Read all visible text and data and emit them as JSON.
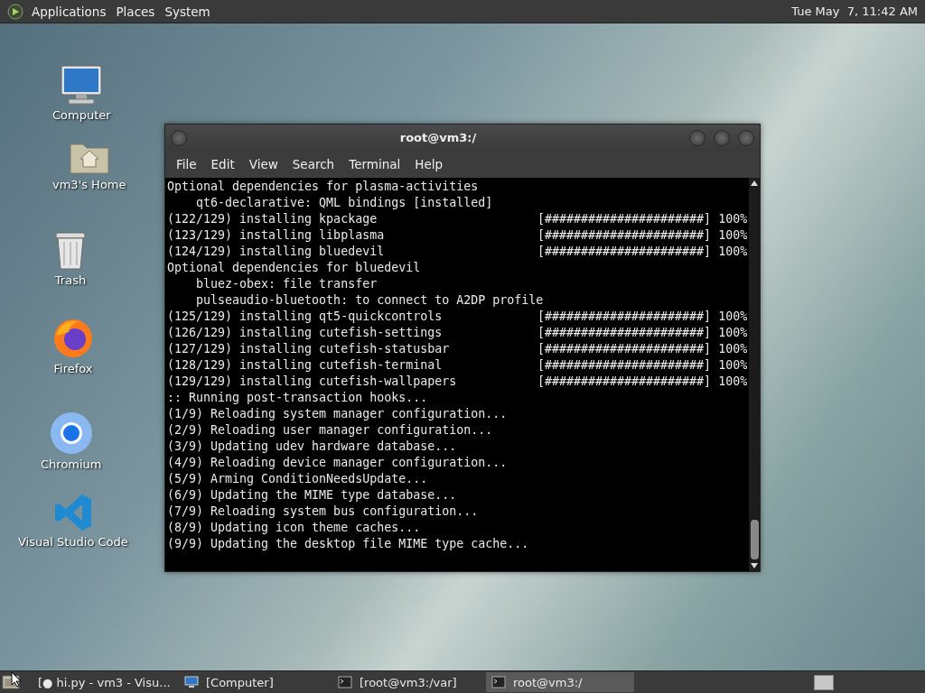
{
  "top_panel": {
    "menus": [
      "Applications",
      "Places",
      "System"
    ],
    "clock": "Tue May  7, 11:42 AM"
  },
  "desktop_icons": [
    {
      "kind": "computer",
      "label": "Computer"
    },
    {
      "kind": "home",
      "label": "vm3's Home"
    },
    {
      "kind": "trash",
      "label": "Trash"
    },
    {
      "kind": "firefox",
      "label": "Firefox"
    },
    {
      "kind": "chromium",
      "label": "Chromium"
    },
    {
      "kind": "vscode",
      "label": "Visual Studio Code"
    }
  ],
  "window": {
    "title": "root@vm3:/",
    "menus": [
      "File",
      "Edit",
      "View",
      "Search",
      "Terminal",
      "Help"
    ],
    "lines": [
      {
        "kind": "text",
        "text": "Optional dependencies for plasma-activities"
      },
      {
        "kind": "text",
        "text": "    qt6-declarative: QML bindings [installed]"
      },
      {
        "kind": "progress",
        "text": "(122/129) installing kpackage",
        "bar": "[######################]",
        "percent": "100%"
      },
      {
        "kind": "progress",
        "text": "(123/129) installing libplasma",
        "bar": "[######################]",
        "percent": "100%"
      },
      {
        "kind": "progress",
        "text": "(124/129) installing bluedevil",
        "bar": "[######################]",
        "percent": "100%"
      },
      {
        "kind": "text",
        "text": "Optional dependencies for bluedevil"
      },
      {
        "kind": "text",
        "text": "    bluez-obex: file transfer"
      },
      {
        "kind": "text",
        "text": "    pulseaudio-bluetooth: to connect to A2DP profile"
      },
      {
        "kind": "progress",
        "text": "(125/129) installing qt5-quickcontrols",
        "bar": "[######################]",
        "percent": "100%"
      },
      {
        "kind": "progress",
        "text": "(126/129) installing cutefish-settings",
        "bar": "[######################]",
        "percent": "100%"
      },
      {
        "kind": "progress",
        "text": "(127/129) installing cutefish-statusbar",
        "bar": "[######################]",
        "percent": "100%"
      },
      {
        "kind": "progress",
        "text": "(128/129) installing cutefish-terminal",
        "bar": "[######################]",
        "percent": "100%"
      },
      {
        "kind": "progress",
        "text": "(129/129) installing cutefish-wallpapers",
        "bar": "[######################]",
        "percent": "100%"
      },
      {
        "kind": "text",
        "text": ":: Running post-transaction hooks..."
      },
      {
        "kind": "text",
        "text": "(1/9) Reloading system manager configuration..."
      },
      {
        "kind": "text",
        "text": "(2/9) Reloading user manager configuration..."
      },
      {
        "kind": "text",
        "text": "(3/9) Updating udev hardware database..."
      },
      {
        "kind": "text",
        "text": "(4/9) Reloading device manager configuration..."
      },
      {
        "kind": "text",
        "text": "(5/9) Arming ConditionNeedsUpdate..."
      },
      {
        "kind": "text",
        "text": "(6/9) Updating the MIME type database..."
      },
      {
        "kind": "text",
        "text": "(7/9) Reloading system bus configuration..."
      },
      {
        "kind": "text",
        "text": "(8/9) Updating icon theme caches..."
      },
      {
        "kind": "text",
        "text": "(9/9) Updating the desktop file MIME type cache..."
      }
    ]
  },
  "taskbar": {
    "tasks": [
      {
        "kind": "vscode",
        "label": "[● hi.py - vm3 - Visu...",
        "selected": false
      },
      {
        "kind": "computer",
        "label": "[Computer]",
        "selected": false
      },
      {
        "kind": "terminal",
        "label": "[root@vm3:/var]",
        "selected": false
      },
      {
        "kind": "terminal",
        "label": "root@vm3:/",
        "selected": true
      }
    ]
  }
}
